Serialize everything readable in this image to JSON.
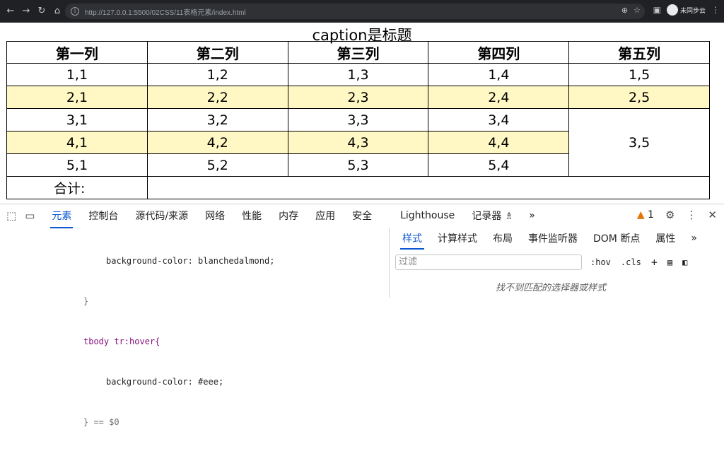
{
  "browser": {
    "url": "http://127.0.0.1:5500/02CSS/11表格元素/index.html",
    "profile_name": "未同步云"
  },
  "page": {
    "caption": "caption是标题",
    "headers": [
      "第一列",
      "第二列",
      "第三列",
      "第四列",
      "第五列"
    ],
    "rows": [
      [
        "1,1",
        "1,2",
        "1,3",
        "1,4",
        "1,5"
      ],
      [
        "2,1",
        "2,2",
        "2,3",
        "2,4",
        "2,5"
      ],
      [
        "3,1",
        "3,2",
        "3,3",
        "3,4"
      ],
      [
        "4,1",
        "4,2",
        "4,3",
        "4,4"
      ],
      [
        "5,1",
        "5,2",
        "5,3",
        "5,4"
      ]
    ],
    "merged_cell": "3,5",
    "sum_label": "合计:",
    "alt_row_color": "#fff8c4"
  },
  "devtools": {
    "tabs": [
      "元素",
      "控制台",
      "源代码/来源",
      "网络",
      "性能",
      "内存",
      "应用",
      "安全",
      "Lighthouse",
      "记录器 ♗",
      "»"
    ],
    "warning_count": "1",
    "code_lines": [
      "background-color: blanchedalmond;",
      "}",
      "tbody tr:hover{",
      "background-color: #eee;",
      "} == $0"
    ],
    "styles_tabs": [
      "样式",
      "计算样式",
      "布局",
      "事件监听器",
      "DOM 断点",
      "属性",
      "»"
    ],
    "filter_placeholder": "过滤",
    "hov_label": ":hov",
    "cls_label": ".cls",
    "no_match_text": "找不到匹配的选择器或样式"
  }
}
